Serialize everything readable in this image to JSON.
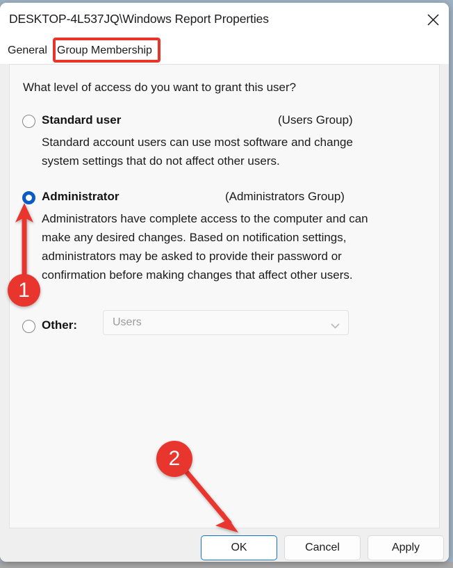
{
  "window": {
    "title": "DESKTOP-4L537JQ\\Windows Report Properties",
    "close_icon": "close-icon"
  },
  "tabs": [
    {
      "label": "General",
      "selected": false
    },
    {
      "label": "Group Membership",
      "selected": true
    }
  ],
  "content": {
    "prompt": "What level of access do you want to grant this user?",
    "options": [
      {
        "label": "Standard user",
        "group": "(Users Group)",
        "description": "Standard account users can use most software and change system settings that do not affect other users.",
        "selected": false
      },
      {
        "label": "Administrator",
        "group": "(Administrators Group)",
        "description": "Administrators have complete access to the computer and can make any desired changes. Based on notification settings, administrators may be asked to provide their password or confirmation before making changes that affect other users.",
        "selected": true
      },
      {
        "label": "Other:",
        "selected": false,
        "select_value": "Users",
        "select_chevron_icon": "chevron-down-icon"
      }
    ]
  },
  "footer": {
    "ok_label": "OK",
    "cancel_label": "Cancel",
    "apply_label": "Apply"
  },
  "annotations": {
    "badge_1": "1",
    "badge_2": "2",
    "accent_color": "#e8362e",
    "highlight_color": "#e8352c",
    "focus_color": "#1473c4",
    "radio_selected_color": "#0a5bc4"
  }
}
